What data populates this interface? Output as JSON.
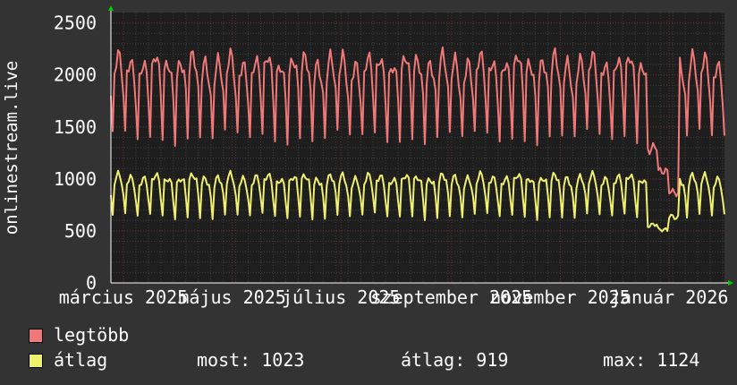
{
  "chart_data": {
    "type": "line",
    "ylabel": "onlinestream.live",
    "ylim": [
      0,
      2600
    ],
    "yticks": [
      0,
      500,
      1000,
      1500,
      2000,
      2500
    ],
    "x_range": [
      "2025-02-22",
      "2026-02-01"
    ],
    "x_ticks": [
      {
        "label": "március 2025",
        "date": "2025-03-01"
      },
      {
        "label": "május 2025",
        "date": "2025-05-01"
      },
      {
        "label": "július 2025",
        "date": "2025-07-01"
      },
      {
        "label": "szeptember 2025",
        "date": "2025-09-01"
      },
      {
        "label": "november 2025",
        "date": "2025-11-01"
      },
      {
        "label": "január 2026",
        "date": "2026-01-01"
      }
    ],
    "grid": true,
    "series": [
      {
        "name": "legtöbb",
        "color": "#f07878",
        "weekly_pattern": [
          1400,
          2000,
          2100,
          2150,
          2100,
          2000,
          1800
        ],
        "dip": {
          "from": "2025-12-20",
          "to": "2026-01-06",
          "values": [
            1300,
            1050,
            880
          ]
        },
        "max": 2480
      },
      {
        "name": "átlag",
        "color": "#f0f070",
        "weekly_pattern": [
          640,
          960,
          1000,
          1020,
          1000,
          960,
          820
        ],
        "dip": {
          "from": "2025-12-20",
          "to": "2026-01-06",
          "values": [
            560,
            500,
            640
          ]
        },
        "max": 1124
      }
    ]
  },
  "legend": {
    "series1": {
      "label": "legtöbb",
      "color": "#f07878"
    },
    "series2": {
      "label": "átlag",
      "color": "#f0f070"
    },
    "stats": {
      "now": "most: 1023",
      "avg": "átlag: 919",
      "max": "max: 1124"
    }
  }
}
